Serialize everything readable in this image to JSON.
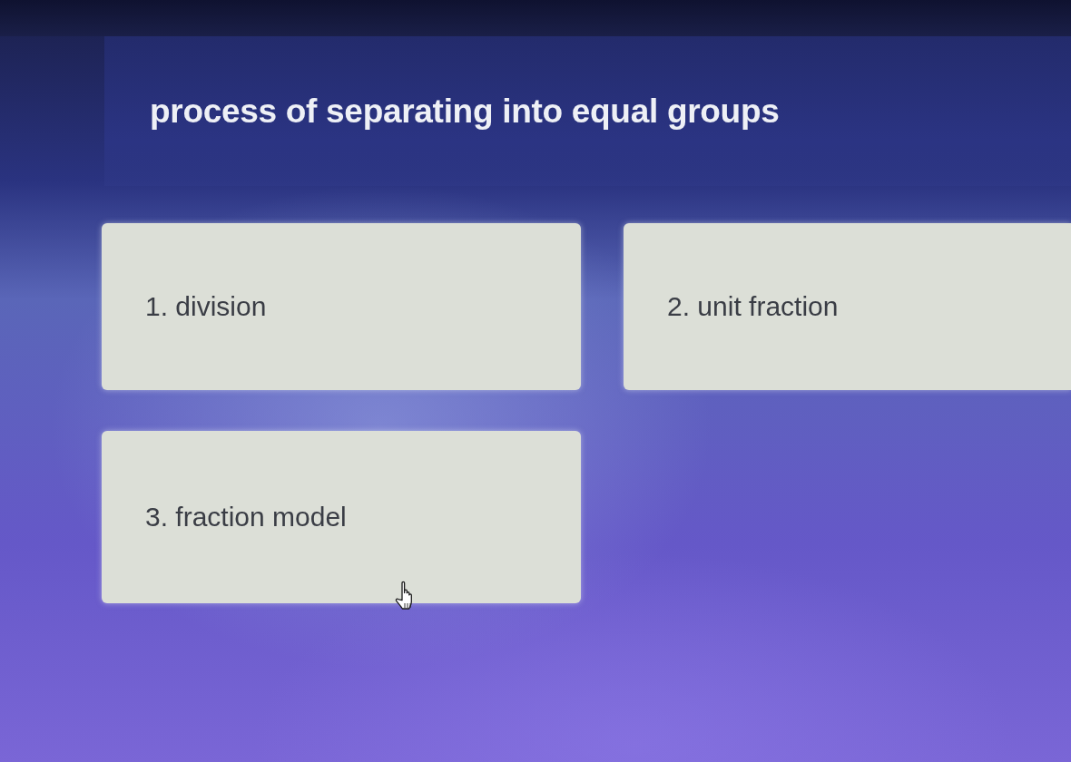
{
  "question": {
    "text": "process of separating into equal groups"
  },
  "options": [
    {
      "label": "1. division"
    },
    {
      "label": "2. unit fraction"
    },
    {
      "label": "3. fraction model"
    }
  ]
}
